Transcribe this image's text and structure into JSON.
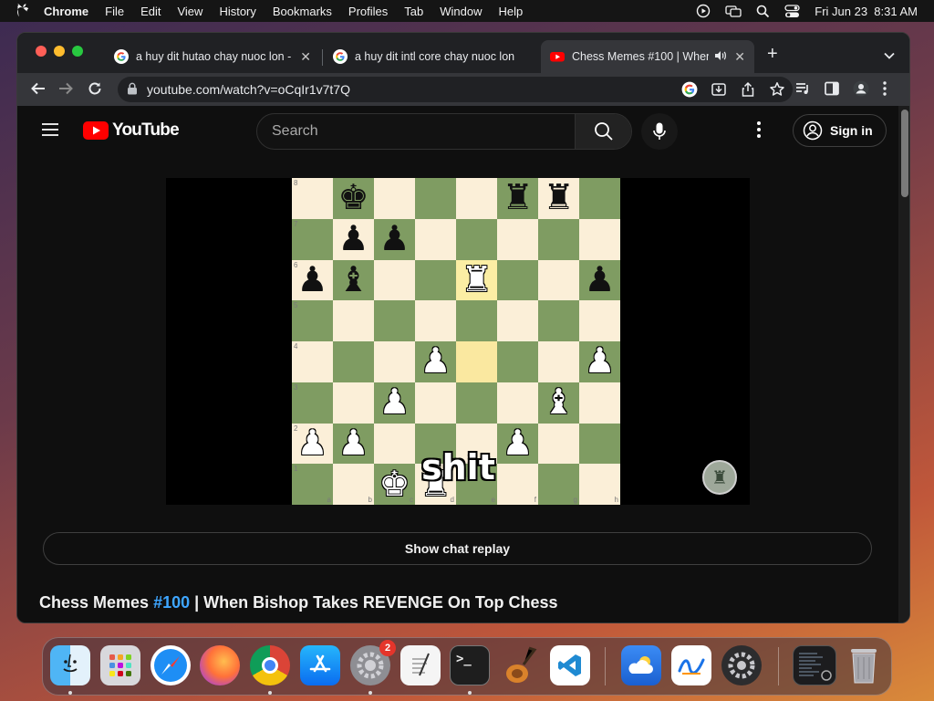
{
  "menubar": {
    "app_name": "Chrome",
    "items": [
      "File",
      "Edit",
      "View",
      "History",
      "Bookmarks",
      "Profiles",
      "Tab",
      "Window",
      "Help"
    ],
    "clock": "Fri Jun 23  8:31 AM"
  },
  "tabs": [
    {
      "title": "a huy dit hutao chay nuoc lon -",
      "favicon": "google-icon"
    },
    {
      "title": "a huy dit intl core chay nuoc lon",
      "favicon": "google-icon"
    },
    {
      "title": "Chess Memes #100 | When",
      "favicon": "youtube-icon",
      "active": true,
      "audio": true
    }
  ],
  "address_bar": {
    "url": "youtube.com/watch?v=oCqIr1v7t7Q"
  },
  "youtube": {
    "logo_text": "YouTube",
    "search_placeholder": "Search",
    "signin_label": "Sign in",
    "chat_replay_label": "Show chat replay",
    "video_title_tag": "#100",
    "video_title_prefix": "Chess Memes ",
    "video_title_suffix": " | When Bishop Takes REVENGE On Top Chess"
  },
  "video": {
    "caption": "shit",
    "board": {
      "ranks": [
        "8",
        "7",
        "6",
        "5",
        "4",
        "3",
        "2",
        "1"
      ],
      "files": [
        "a",
        "b",
        "c",
        "d",
        "e",
        "f",
        "g",
        "h"
      ],
      "position": [
        [
          "",
          "bK",
          "",
          "",
          "",
          "bR",
          "bR",
          ""
        ],
        [
          "",
          "bP",
          "bP",
          "",
          "",
          "",
          "",
          ""
        ],
        [
          "bP",
          "bB",
          "",
          "",
          "wR",
          "",
          "",
          "bP"
        ],
        [
          "",
          "",
          "",
          "",
          "",
          "",
          "",
          ""
        ],
        [
          "",
          "",
          "",
          "wP",
          "",
          "",
          "",
          "wP"
        ],
        [
          "",
          "",
          "wP",
          "",
          "",
          "",
          "wB",
          ""
        ],
        [
          "wP",
          "wP",
          "",
          "",
          "",
          "wP",
          "",
          ""
        ],
        [
          "",
          "",
          "wK",
          "wR",
          "",
          "",
          "",
          ""
        ]
      ],
      "highlights": [
        "e6",
        "e4"
      ]
    }
  },
  "dock": {
    "settings_badge": "2",
    "apps": [
      "finder-icon",
      "launchpad-icon",
      "safari-icon",
      "firefox-icon",
      "chrome-icon",
      "app-store-icon",
      "system-settings-icon",
      "textedit-icon",
      "terminal-icon",
      "garageband-icon",
      "vscode-icon",
      "weather-icon",
      "freeform-icon",
      "utility-icon",
      "window-thumbnail",
      "trash-icon"
    ]
  }
}
